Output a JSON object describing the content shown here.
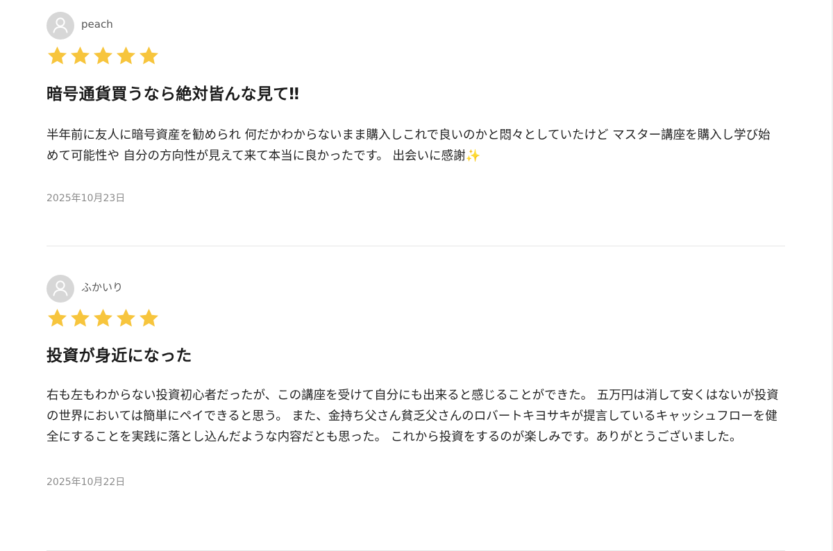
{
  "reviews": [
    {
      "author": "peach",
      "rating": 5,
      "title": "暗号通貨買うなら絶対皆んな見て‼︎",
      "body": "半年前に友人に暗号資産を勧められ 何だかわからないまま購入しこれで良いのかと悶々としていたけど マスター講座を購入し学び始めて可能性や 自分の方向性が見えて来て本当に良かったです。 出会いに感謝✨",
      "date": "2025年10月23日"
    },
    {
      "author": "ふかいり",
      "rating": 5,
      "title": "投資が身近になった",
      "body": "右も左もわからない投資初心者だったが、この講座を受けて自分にも出来ると感じることができた。 五万円は消して安くはないが投資の世界においては簡単にペイできると思う。 また、金持ち父さん貧乏父さんのロバートキヨサキが提言しているキャッシュフローを健全にすることを実践に落とし込んだような内容だとも思った。 これから投資をするのが楽しみです。ありがとうございました。",
      "date": "2025年10月22日"
    }
  ],
  "icons": {
    "avatar": "user-silhouette-icon",
    "star": "star-icon"
  },
  "colors": {
    "star": "#f7c53d",
    "avatar_bg": "#d7d7d7",
    "divider": "#e6e6e6"
  }
}
